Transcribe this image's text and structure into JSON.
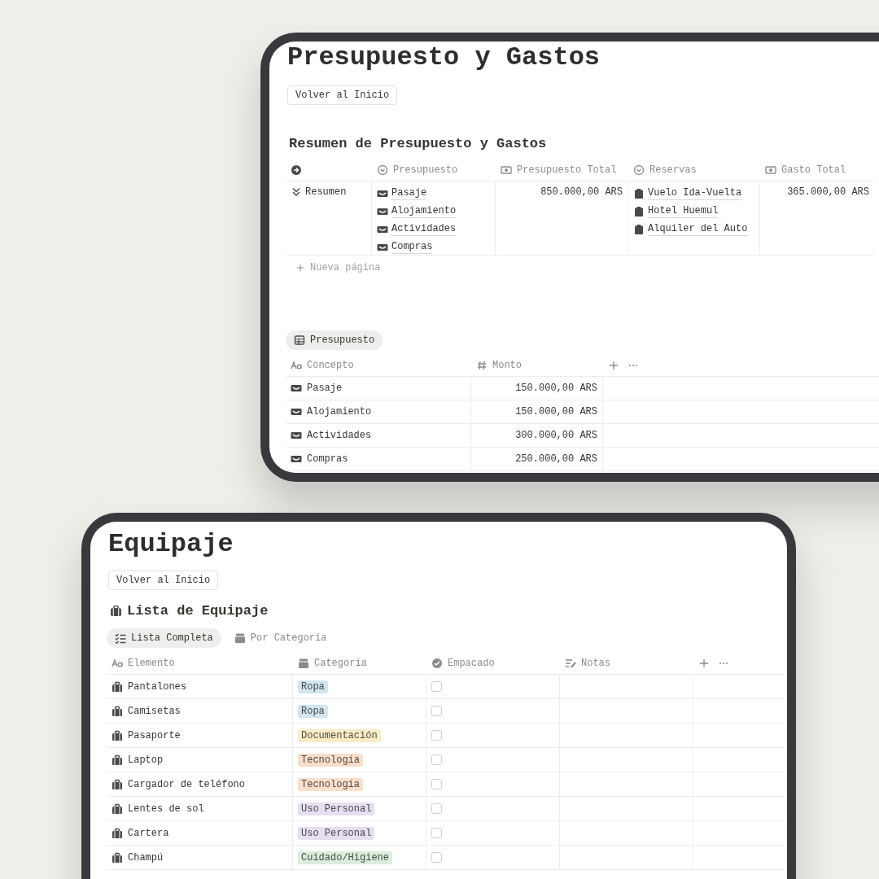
{
  "budget_page": {
    "title": "Presupuesto y Gastos",
    "back_button": "Volver al Inicio",
    "summary": {
      "heading": "Resumen de Presupuesto y Gastos",
      "columns": [
        {
          "kind": "title"
        },
        {
          "kind": "relation",
          "label": "Presupuesto"
        },
        {
          "kind": "rollup",
          "label": "Presupuesto Total"
        },
        {
          "kind": "relation",
          "label": "Reservas"
        },
        {
          "kind": "rollup",
          "label": "Gasto Total"
        }
      ],
      "rows": [
        {
          "cells": [
            "Resumen",
            [
              {
                "label": "Pasaje",
                "kind": "budget"
              },
              {
                "label": "Alojamiento",
                "kind": "budget"
              },
              {
                "label": "Actividades",
                "kind": "budget"
              },
              {
                "label": "Compras",
                "kind": "budget"
              }
            ],
            "850.000,00 ARS",
            [
              {
                "label": "Vuelo Ida-Vuelta",
                "kind": "booking"
              },
              {
                "label": "Hotel Huemul",
                "kind": "booking"
              },
              {
                "label": "Alquiler del Auto",
                "kind": "booking"
              }
            ],
            "365.000,00 ARS"
          ]
        }
      ],
      "new_page": "Nueva página"
    },
    "budget_table": {
      "tabs": [
        {
          "label": "Presupuesto",
          "selected": true
        }
      ],
      "columns": [
        {
          "kind": "title",
          "label": "Concepto"
        },
        {
          "kind": "number",
          "label": "Monto"
        },
        {
          "kind": "add"
        }
      ],
      "rows": [
        {
          "concepto": "Pasaje",
          "monto": "150.000,00 ARS"
        },
        {
          "concepto": "Alojamiento",
          "monto": "150.000,00 ARS"
        },
        {
          "concepto": "Actividades",
          "monto": "300.000,00 ARS"
        },
        {
          "concepto": "Compras",
          "monto": "250.000,00 ARS"
        }
      ]
    }
  },
  "luggage_page": {
    "title": "Equipaje",
    "back_button": "Volver al Inicio",
    "heading": "Lista de Equipaje",
    "tabs": [
      {
        "label": "Lista Completa",
        "selected": true
      },
      {
        "label": "Por Categoría",
        "selected": false
      }
    ],
    "columns": [
      {
        "kind": "title",
        "label": "Elemento"
      },
      {
        "kind": "select",
        "label": "Categoría"
      },
      {
        "kind": "checkbox",
        "label": "Empacado"
      },
      {
        "kind": "text",
        "label": "Notas"
      },
      {
        "kind": "add"
      }
    ],
    "rows": [
      {
        "name": "Pantalones",
        "category": {
          "label": "Ropa",
          "color": "#d3e5ef"
        },
        "packed": false
      },
      {
        "name": "Camisetas",
        "category": {
          "label": "Ropa",
          "color": "#d3e5ef"
        },
        "packed": false
      },
      {
        "name": "Pasaporte",
        "category": {
          "label": "Documentación",
          "color": "#fbecc8"
        },
        "packed": false
      },
      {
        "name": "Laptop",
        "category": {
          "label": "Tecnología",
          "color": "#f9dfcb"
        },
        "packed": false
      },
      {
        "name": "Cargador de teléfono",
        "category": {
          "label": "Tecnología",
          "color": "#f9dfcb"
        },
        "packed": false
      },
      {
        "name": "Lentes de sol",
        "category": {
          "label": "Uso Personal",
          "color": "#e8def1"
        },
        "packed": false
      },
      {
        "name": "Cartera",
        "category": {
          "label": "Uso Personal",
          "color": "#e8def1"
        },
        "packed": false
      },
      {
        "name": "Champú",
        "category": {
          "label": "Cuidado/Higiene",
          "color": "#dbeddb"
        },
        "packed": false
      }
    ]
  }
}
